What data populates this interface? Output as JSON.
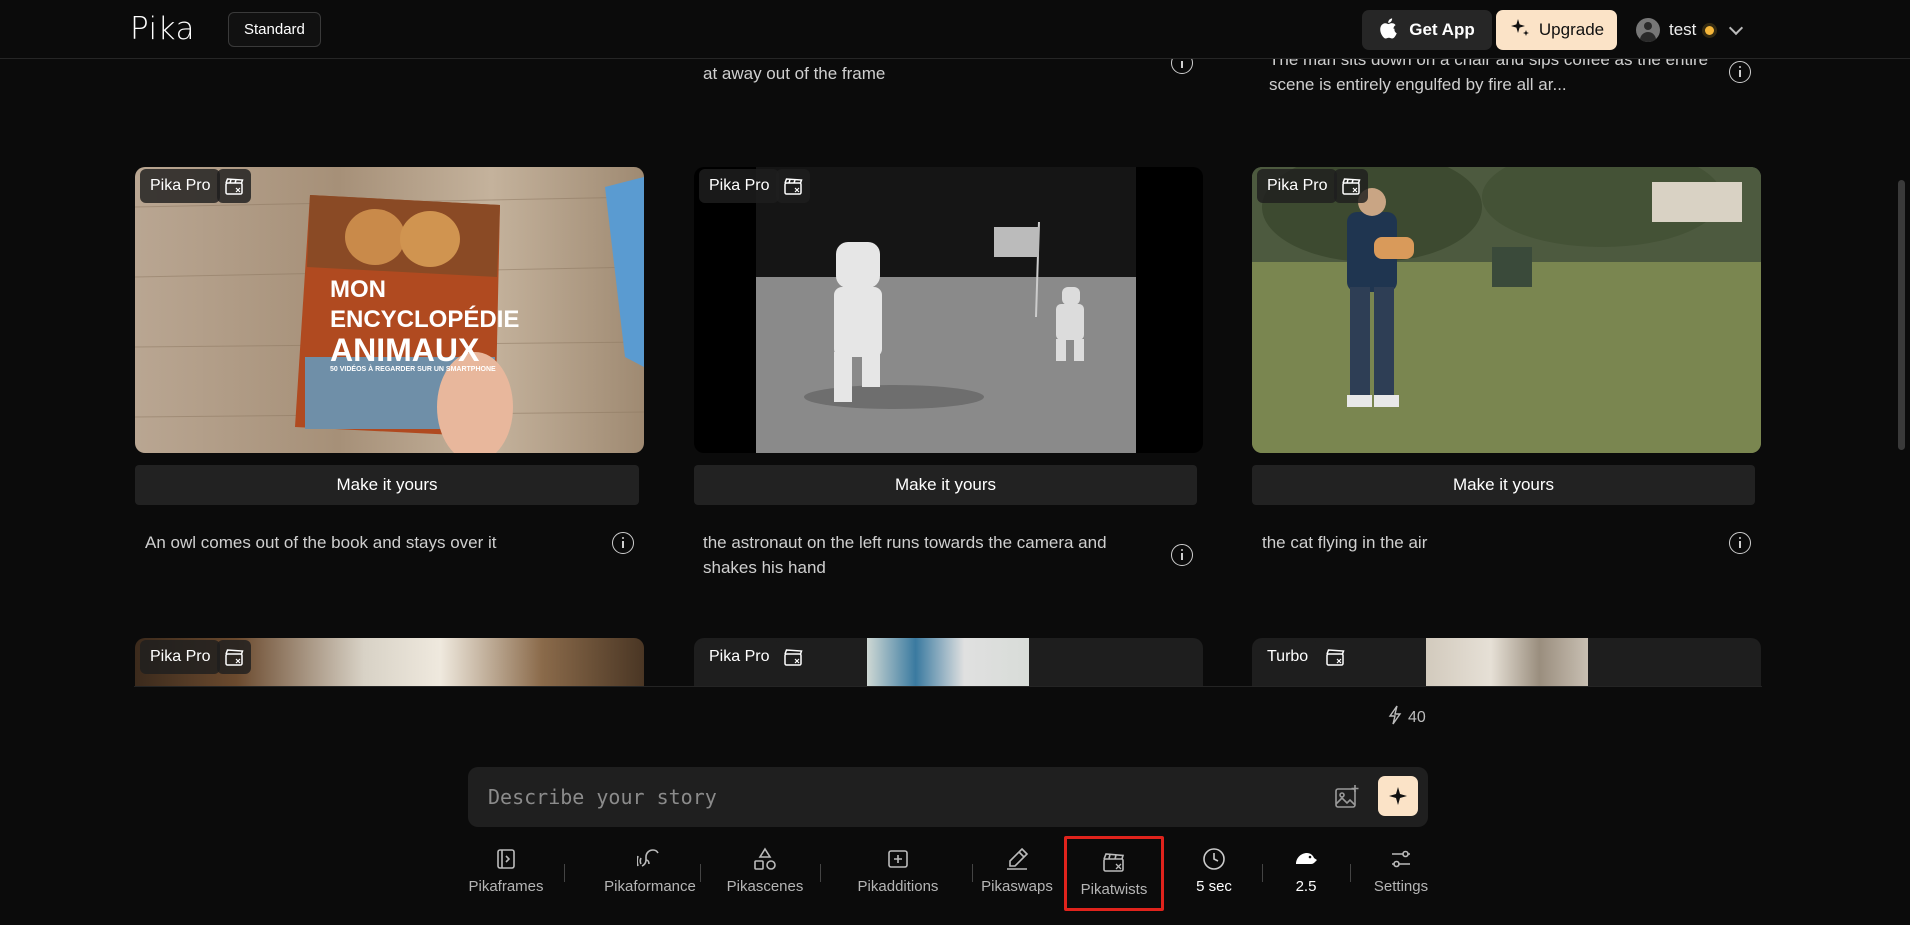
{
  "header": {
    "logo": "Pika",
    "plan": "Standard",
    "get_app": "Get App",
    "upgrade": "Upgrade",
    "username": "test"
  },
  "top_captions": {
    "middle": "at away out of the frame",
    "right": "The man sits down on a chair and sips coffee as the entire scene is entirely engulfed by fire all ar..."
  },
  "cards": [
    {
      "badge": "Pika Pro",
      "make_label": "Make it yours",
      "caption": "An owl comes out of the book and stays over it",
      "book_title_1": "MON",
      "book_title_2": "ENCYCLOPÉDIE",
      "book_title_3": "ANIMAUX",
      "book_subtitle": "50 VIDÉOS À REGARDER SUR UN SMARTPHONE"
    },
    {
      "badge": "Pika Pro",
      "make_label": "Make it yours",
      "caption": "the astronaut on the left runs towards the camera and shakes his hand"
    },
    {
      "badge": "Pika Pro",
      "make_label": "Make it yours",
      "caption": "the cat flying in the air"
    }
  ],
  "partial_cards": [
    {
      "badge": "Pika Pro"
    },
    {
      "badge": "Pika Pro"
    },
    {
      "badge": "Turbo"
    }
  ],
  "credits": "40",
  "prompt": {
    "placeholder": "Describe your story"
  },
  "toolbar": [
    {
      "label": "Pikaframes",
      "icon": "pikaframes-icon"
    },
    {
      "label": "Pikaformance",
      "icon": "pikaformance-icon"
    },
    {
      "label": "Pikascenes",
      "icon": "pikascenes-icon"
    },
    {
      "label": "Pikadditions",
      "icon": "pikadditions-icon"
    },
    {
      "label": "Pikaswaps",
      "icon": "pikaswaps-icon"
    },
    {
      "label": "Pikatwists",
      "icon": "pikatwists-icon",
      "highlighted": true
    },
    {
      "label": "5 sec",
      "icon": "clock-icon"
    },
    {
      "label": "2.5",
      "icon": "model-version-icon"
    },
    {
      "label": "Settings",
      "icon": "settings-sliders-icon"
    }
  ],
  "colors": {
    "accent": "#fbe3c7",
    "highlight": "#e0231c",
    "background": "#0b0b0b"
  }
}
